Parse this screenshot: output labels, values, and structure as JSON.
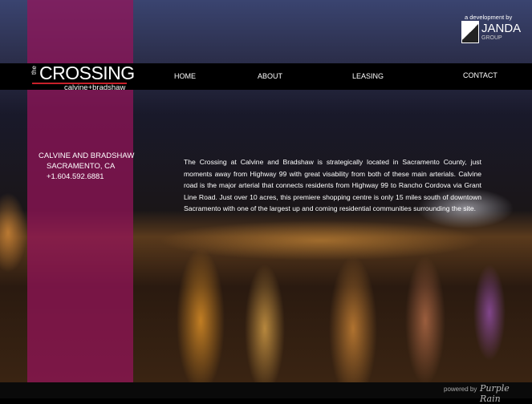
{
  "branding": {
    "logo_the": "the",
    "logo_main": "CROSSING",
    "logo_sub": "calvine+bradshaw"
  },
  "nav": [
    {
      "label": "HOME"
    },
    {
      "label": "ABOUT"
    },
    {
      "label": "LEASING"
    },
    {
      "label": "CONTACT"
    }
  ],
  "developer": {
    "caption": "a development by",
    "name": "JANDA",
    "group": "GROUP"
  },
  "address": {
    "line1": "CALVINE AND BRADSHAW",
    "line2": "SACRAMENTO, CA",
    "phone": "+1.604.592.6881"
  },
  "description": "The Crossing at Calvine and Bradshaw is strategically located in Sacramento County, just moments away from Highway 99 with great visability from both of these main arterials. Calvine road is the major arterial that connects residents from Highway 99 to Rancho Cordova via Grant Line Road.  Just over 10 acres, this premiere shopping centre is only 15 miles south of downtown Sacramento with one of the largest up and coming residential communities surrounding the site.",
  "footer": {
    "powered_by": "powered by",
    "logo": "Purple Rain"
  }
}
